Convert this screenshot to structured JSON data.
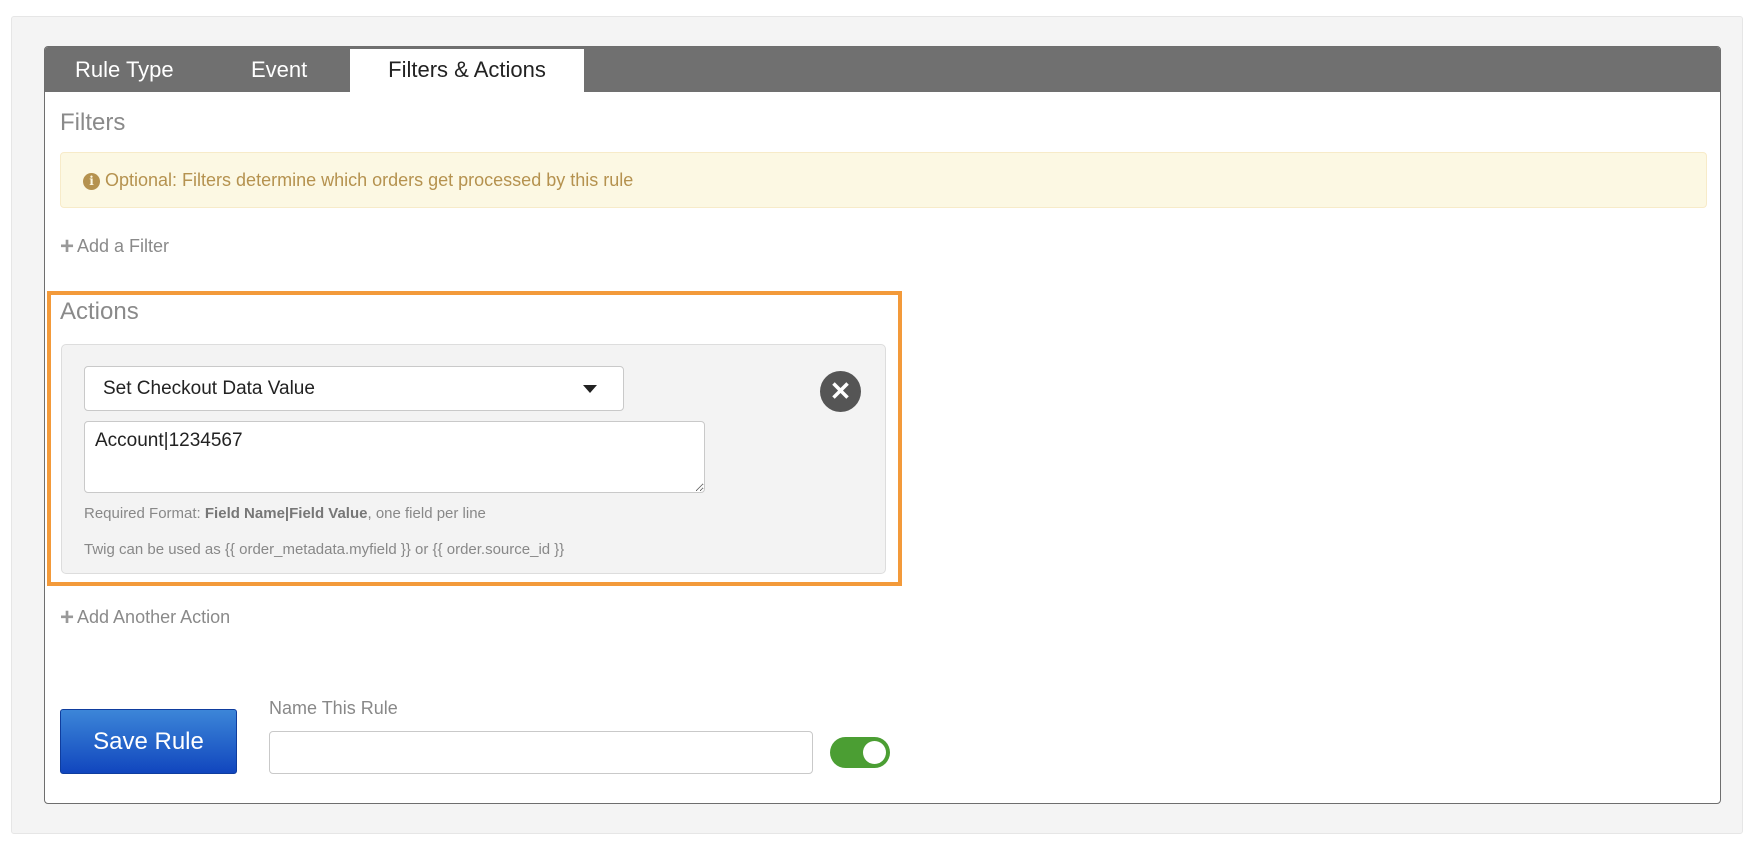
{
  "tabs": [
    {
      "label": "Rule Type"
    },
    {
      "label": "Event"
    },
    {
      "label": "Filters & Actions",
      "active": true
    }
  ],
  "filters": {
    "heading": "Filters",
    "alert": "Optional: Filters determine which orders get processed by this rule",
    "add_label": "Add a Filter"
  },
  "actions": {
    "heading": "Actions",
    "select_value": "Set Checkout Data Value",
    "textarea_value": "Account|1234567",
    "help1_prefix": "Required Format: ",
    "help1_bold": "Field Name|Field Value",
    "help1_suffix": ", one field per line",
    "help2": "Twig can be used as {{ order_metadata.myfield }} or {{ order.source_id }}",
    "add_label": "Add Another Action"
  },
  "footer": {
    "save_label": "Save Rule",
    "name_label": "Name This Rule",
    "name_value": "",
    "toggle_on": true
  },
  "colors": {
    "highlight": "#f39a3a",
    "toggle": "#4b9e33",
    "save": "#1f5fc8"
  }
}
